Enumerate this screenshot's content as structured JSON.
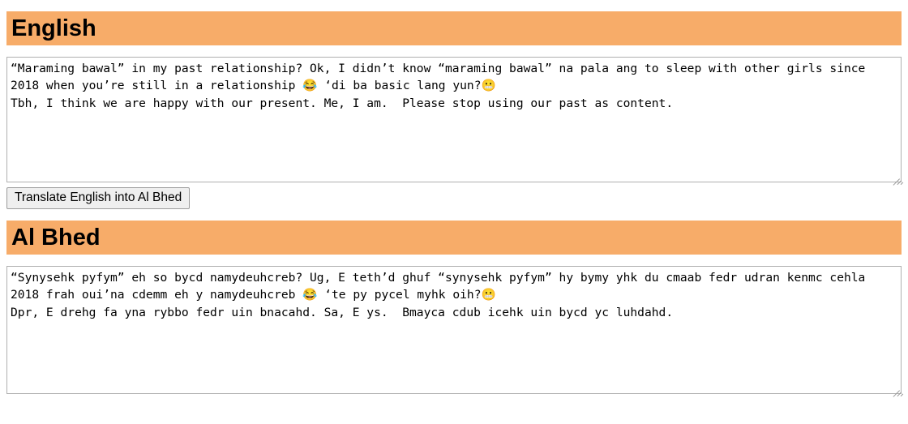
{
  "colors": {
    "header_background": "#F7AC69",
    "header_text": "#000000",
    "textarea_border": "#AFAFAF",
    "button_background": "#EFEFEF",
    "button_border": "#9B9B9B",
    "page_background": "#FFFFFF"
  },
  "sections": {
    "source": {
      "heading": "English",
      "textarea": {
        "value": "“Maraming bawal” in my past relationship? Ok, I didn’t know “maraming bawal” na pala ang to sleep with other girls since 2018 when you’re still in a relationship 😂 ‘di ba basic lang yun?😬\nTbh, I think we are happy with our present. Me, I am.  Please stop using our past as content.",
        "placeholder": ""
      }
    },
    "target": {
      "heading": "Al Bhed",
      "textarea": {
        "value": "“Synysehk pyfym” eh so bycd namydeuhcreb? Ug, E teth’d ghuf “synysehk pyfym” hy bymy yhk du cmaab fedr udran kenmc cehla 2018 frah oui’na cdemm eh y namydeuhcreb 😂 ‘te py pycel myhk oih?😬\nDpr, E drehg fa yna rybbo fedr uin bnacahd. Sa, E ys.  Bmayca cdub icehk uin bycd yc luhdahd.",
        "placeholder": ""
      }
    }
  },
  "buttons": {
    "translate": {
      "label": "Translate English into Al Bhed"
    }
  },
  "icons": {
    "resize_grip": "resize-grip-icon",
    "emoji_joy": "face-with-tears-of-joy-emoji",
    "emoji_grimacing": "grimacing-face-emoji"
  }
}
